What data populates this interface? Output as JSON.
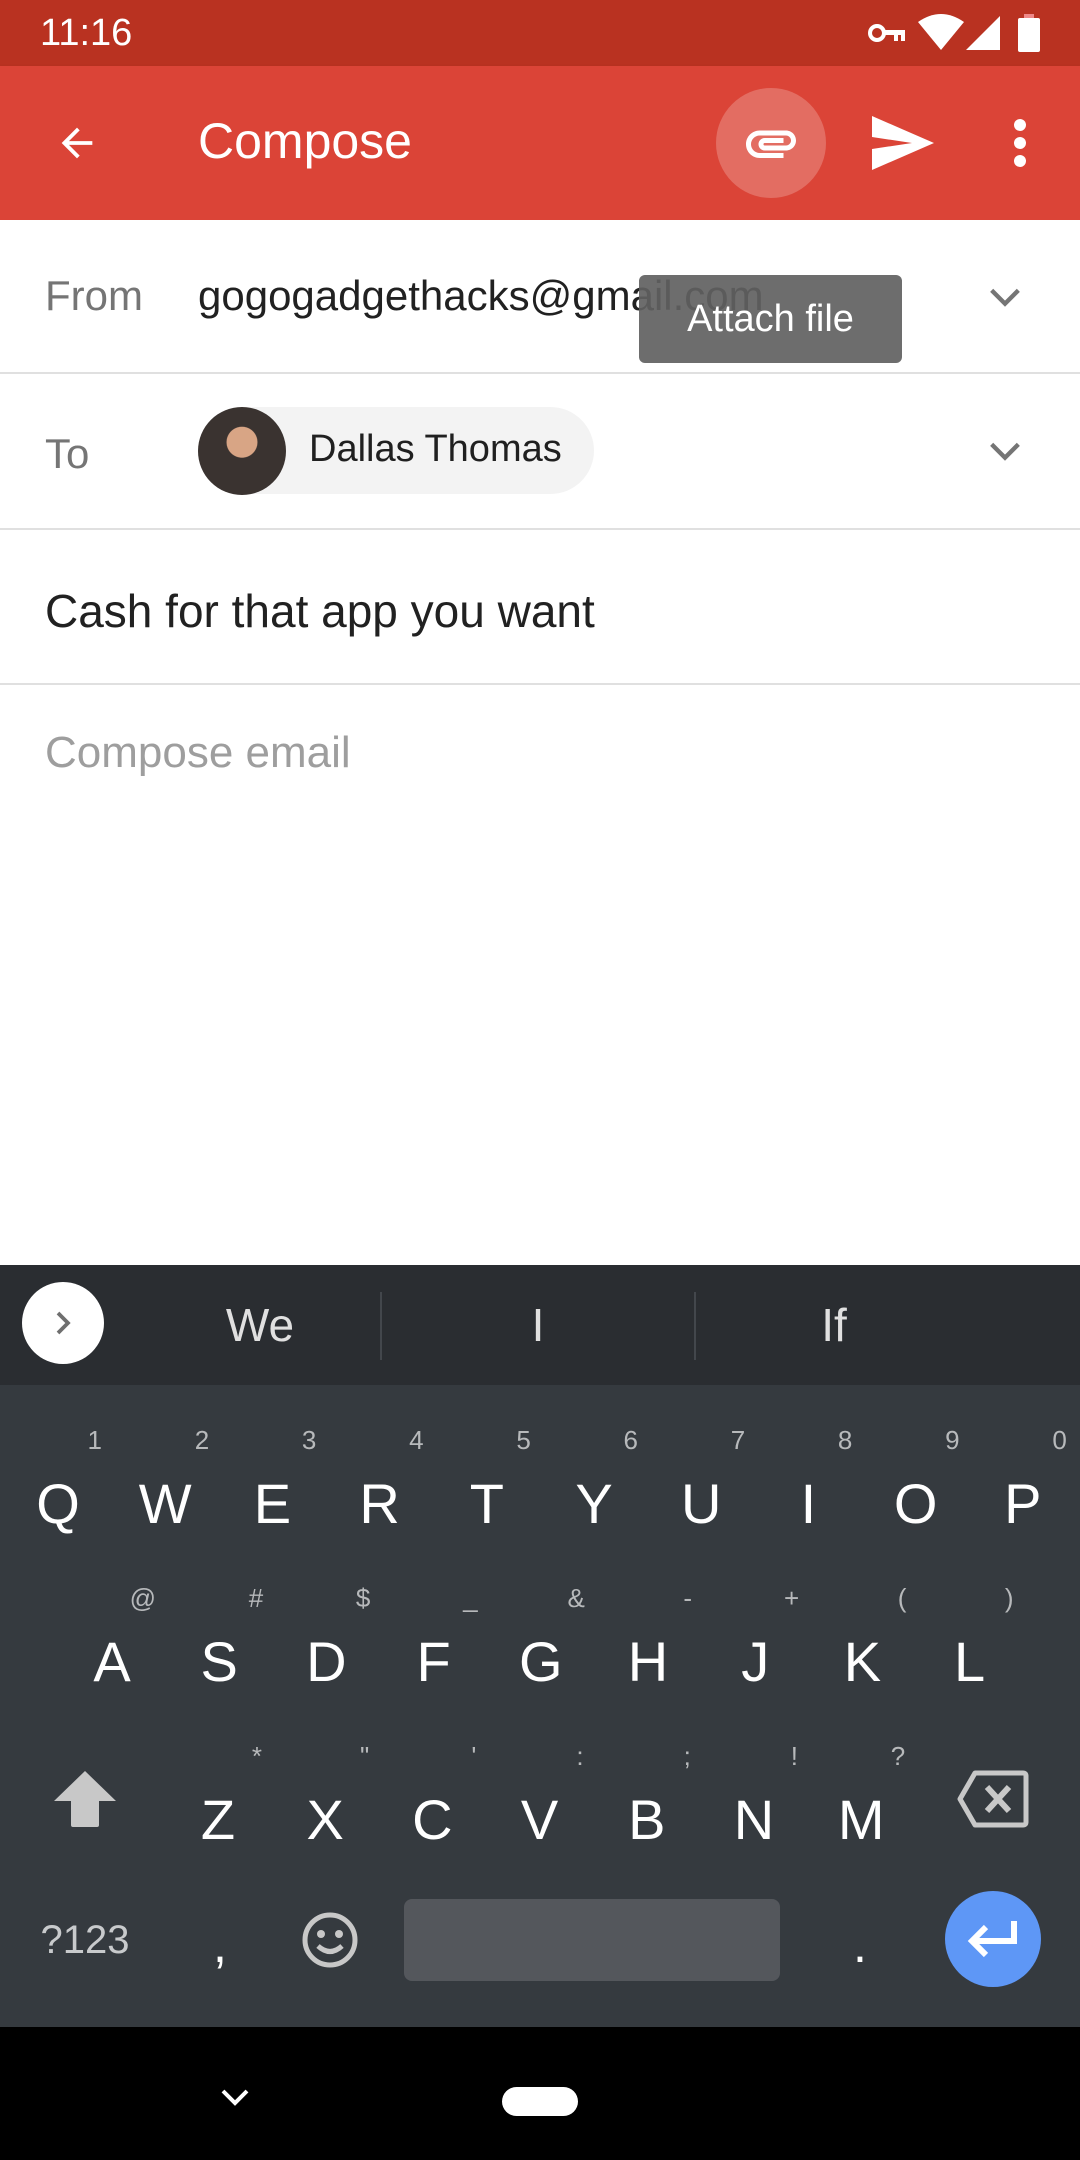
{
  "status_bar": {
    "time": "11:16",
    "icons": [
      "vpn-key-icon",
      "wifi-icon",
      "cell-signal-icon",
      "battery-icon"
    ]
  },
  "app_bar": {
    "title": "Compose",
    "back_icon": "arrow-back-icon",
    "actions": [
      {
        "name": "attach",
        "icon": "paperclip-icon",
        "pressed": true
      },
      {
        "name": "send",
        "icon": "send-icon"
      },
      {
        "name": "more",
        "icon": "more-vert-icon"
      }
    ]
  },
  "tooltip": {
    "text": "Attach file"
  },
  "from_field": {
    "label": "From",
    "value": "gogogadgethacks@gmail.com"
  },
  "to_field": {
    "label": "To",
    "recipients": [
      {
        "name": "Dallas Thomas"
      }
    ]
  },
  "subject_field": {
    "value": "Cash for that app you want"
  },
  "body_field": {
    "placeholder": "Compose email",
    "value": ""
  },
  "keyboard": {
    "suggestions": [
      "We",
      "I",
      "If"
    ],
    "row1": [
      {
        "key": "Q",
        "hint": "1"
      },
      {
        "key": "W",
        "hint": "2"
      },
      {
        "key": "E",
        "hint": "3"
      },
      {
        "key": "R",
        "hint": "4"
      },
      {
        "key": "T",
        "hint": "5"
      },
      {
        "key": "Y",
        "hint": "6"
      },
      {
        "key": "U",
        "hint": "7"
      },
      {
        "key": "I",
        "hint": "8"
      },
      {
        "key": "O",
        "hint": "9"
      },
      {
        "key": "P",
        "hint": "0"
      }
    ],
    "row2": [
      {
        "key": "A",
        "hint": "@"
      },
      {
        "key": "S",
        "hint": "#"
      },
      {
        "key": "D",
        "hint": "$"
      },
      {
        "key": "F",
        "hint": "_"
      },
      {
        "key": "G",
        "hint": "&"
      },
      {
        "key": "H",
        "hint": "-"
      },
      {
        "key": "J",
        "hint": "+"
      },
      {
        "key": "K",
        "hint": "("
      },
      {
        "key": "L",
        "hint": ")"
      }
    ],
    "row3": [
      {
        "key": "Z",
        "hint": "*"
      },
      {
        "key": "X",
        "hint": "\""
      },
      {
        "key": "C",
        "hint": "'"
      },
      {
        "key": "V",
        "hint": ":"
      },
      {
        "key": "B",
        "hint": ";"
      },
      {
        "key": "N",
        "hint": "!"
      },
      {
        "key": "M",
        "hint": "?"
      }
    ],
    "symbols_key": "?123",
    "comma_key": ",",
    "period_key": ".",
    "enter_color": "#5e97f6"
  },
  "colors": {
    "status_bar": "#b93221",
    "app_bar": "#db4437",
    "keyboard_bg": "#353a3f",
    "suggestion_bg": "#2a2d31"
  }
}
